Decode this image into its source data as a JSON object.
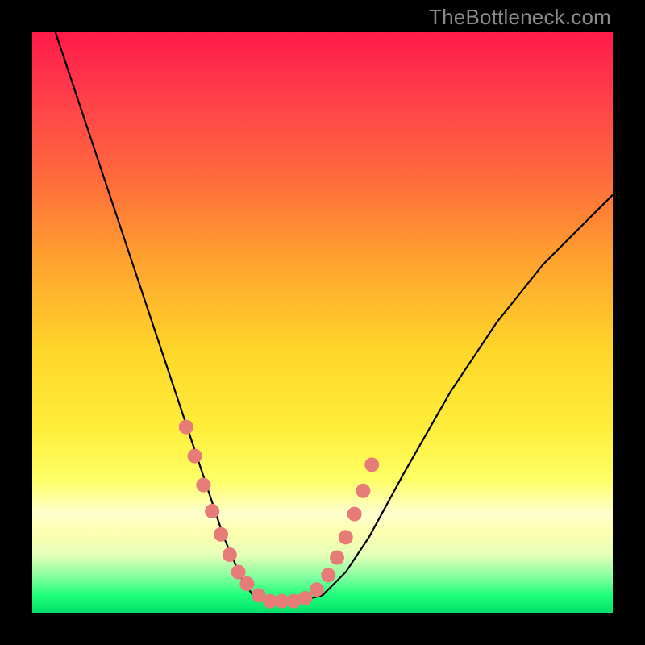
{
  "watermark": "TheBottleneck.com",
  "chart_data": {
    "type": "line",
    "title": "",
    "xlabel": "",
    "ylabel": "",
    "xlim": [
      0,
      100
    ],
    "ylim": [
      0,
      100
    ],
    "grid": false,
    "legend": false,
    "background_gradient": [
      "#ff1a4a",
      "#ffd62a",
      "#ffff66",
      "#1eff7a"
    ],
    "series": [
      {
        "name": "bottleneck-curve",
        "color": "#000000",
        "x": [
          4,
          8,
          12,
          16,
          20,
          24,
          28,
          30,
          33,
          36,
          38,
          40,
          42,
          46,
          50,
          54,
          58,
          64,
          72,
          80,
          88,
          96,
          100
        ],
        "values": [
          100,
          88,
          76,
          64,
          52,
          40,
          28,
          22,
          13,
          6,
          3,
          2,
          2,
          2,
          3,
          7,
          13,
          24,
          38,
          50,
          60,
          68,
          72
        ]
      }
    ],
    "annotations": [
      {
        "name": "marker-dots",
        "type": "scatter",
        "color": "#e77b78",
        "x": [
          26.5,
          28.0,
          29.5,
          31.0,
          32.5,
          34.0,
          35.5,
          37.0,
          39.0,
          41.0,
          43.0,
          45.0,
          47.0,
          49.0,
          51.0,
          52.5,
          54.0,
          55.5,
          57.0,
          58.5
        ],
        "values": [
          32.0,
          27.0,
          22.0,
          17.5,
          13.5,
          10.0,
          7.0,
          5.0,
          3.0,
          2.0,
          2.0,
          2.0,
          2.5,
          4.0,
          6.5,
          9.5,
          13.0,
          17.0,
          21.0,
          25.5
        ]
      }
    ]
  }
}
